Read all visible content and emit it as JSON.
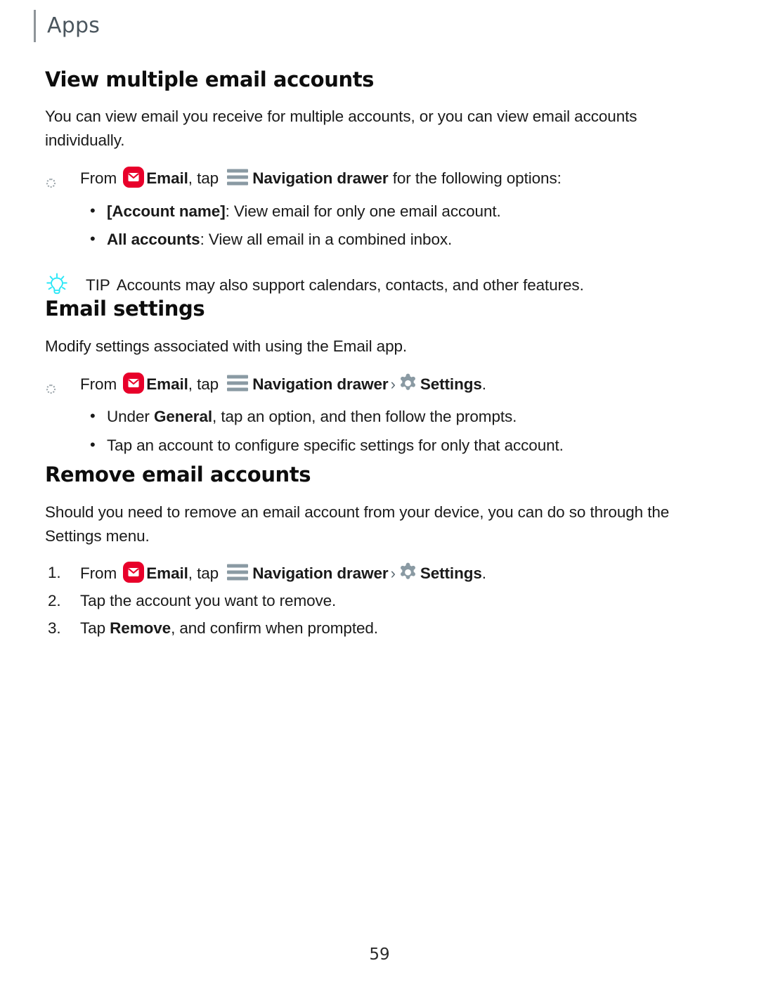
{
  "header": {
    "title": "Apps"
  },
  "icons": {
    "email": "email-app-icon",
    "drawer": "navigation-drawer-icon",
    "gear": "settings-gear-icon",
    "tip": "lightbulb-tip-icon",
    "chevron": "›"
  },
  "colors": {
    "email_icon_red": "#e8002a",
    "drawer_gray": "#8a9aa3",
    "gear_gray": "#8a9aa3",
    "tip_cyan": "#28e7f7",
    "header_rule": "#8e9499",
    "header_text": "#4b565e",
    "body_text": "#1a1a1a"
  },
  "sections": [
    {
      "heading": "View multiple email accounts",
      "intro": "You can view email you receive for multiple accounts, or you can view email accounts individually.",
      "steps": [
        {
          "marker": "circle",
          "parts": [
            {
              "text": "From ",
              "style": "normal"
            },
            {
              "icon": "email"
            },
            {
              "text": "Email",
              "style": "bold"
            },
            {
              "text": ", tap ",
              "style": "normal"
            },
            {
              "icon": "drawer"
            },
            {
              "text": "Navigation drawer",
              "style": "bold"
            },
            {
              "text": " for the following options:",
              "style": "normal"
            }
          ]
        }
      ],
      "sub_bullets": [
        {
          "lead": "[Account name]",
          "rest": ": View email for only one email account."
        },
        {
          "lead": "All accounts",
          "rest": ": View all email in a combined inbox."
        }
      ],
      "tip": {
        "label": "TIP",
        "text": "Accounts may also support calendars, contacts, and other features."
      }
    },
    {
      "heading": "Email settings",
      "intro": "Modify settings associated with using the Email app.",
      "steps": [
        {
          "marker": "circle",
          "parts": [
            {
              "text": "From ",
              "style": "normal"
            },
            {
              "icon": "email"
            },
            {
              "text": "Email",
              "style": "bold"
            },
            {
              "text": ", tap ",
              "style": "normal"
            },
            {
              "icon": "drawer"
            },
            {
              "text": "Navigation drawer",
              "style": "bold"
            },
            {
              "icon": "chevron"
            },
            {
              "icon": "gear"
            },
            {
              "text": "Settings",
              "style": "bold"
            },
            {
              "text": ".",
              "style": "normal"
            }
          ]
        }
      ],
      "sub_bullets": [
        {
          "lead": "General",
          "rest": ", tap an option, and then follow the prompts.",
          "prefix": "Under "
        },
        {
          "lead": "",
          "rest": "Tap an account to configure specific settings for only that account."
        }
      ]
    },
    {
      "heading": "Remove email accounts",
      "intro": "Should you need to remove an email account from your device, you can do so through the Settings menu.",
      "steps": [
        {
          "marker": "1.",
          "parts": [
            {
              "text": "From ",
              "style": "normal"
            },
            {
              "icon": "email"
            },
            {
              "text": "Email",
              "style": "bold"
            },
            {
              "text": ", tap ",
              "style": "normal"
            },
            {
              "icon": "drawer"
            },
            {
              "text": "Navigation drawer",
              "style": "bold"
            },
            {
              "icon": "chevron"
            },
            {
              "icon": "gear"
            },
            {
              "text": "Settings",
              "style": "bold"
            },
            {
              "text": ".",
              "style": "normal"
            }
          ]
        },
        {
          "marker": "2.",
          "parts": [
            {
              "text": "Tap the account you want to remove.",
              "style": "normal"
            }
          ]
        },
        {
          "marker": "3.",
          "parts": [
            {
              "text": "Tap ",
              "style": "normal"
            },
            {
              "text": "Remove",
              "style": "bold"
            },
            {
              "text": ", and confirm when prompted.",
              "style": "normal"
            }
          ]
        }
      ]
    }
  ],
  "footer": {
    "page_number": "59"
  }
}
